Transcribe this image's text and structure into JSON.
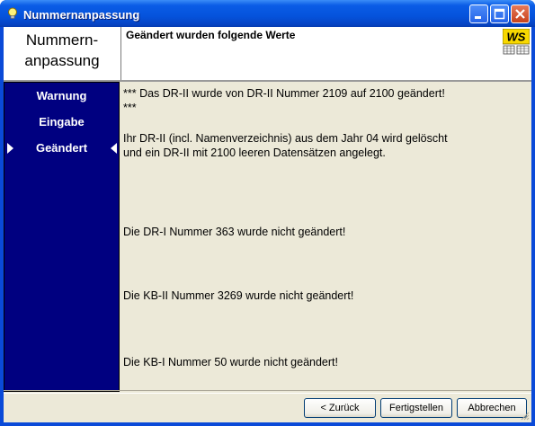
{
  "window": {
    "title": "Nummernanpassung"
  },
  "header": {
    "left_title_line1": "Nummern-",
    "left_title_line2": "anpassung",
    "heading": "Geändert wurden folgende Werte",
    "logo_text": "WS"
  },
  "sidebar": {
    "items": [
      {
        "label": "Warnung"
      },
      {
        "label": "Eingabe"
      },
      {
        "label": "Geändert",
        "active": true
      }
    ]
  },
  "content": {
    "paragraphs": [
      "*** Das DR-II wurde von DR-II Nummer 2109 auf 2100 geändert! ***",
      "Ihr DR-II (incl. Namenverzeichnis) aus dem Jahr 04 wird gelöscht und ein DR-II mit 2100 leeren Datensätzen angelegt.",
      "Die DR-I Nummer 363 wurde nicht geändert!",
      "Die KB-II Nummer 3269 wurde nicht geändert!",
      "Die KB-I Nummer 50 wurde nicht geändert!"
    ]
  },
  "buttons": {
    "back": "< Zurück",
    "finish": "Fertigstellen",
    "cancel": "Abbrechen"
  },
  "colors": {
    "titlebar": "#0553dc",
    "sidebar": "#000080",
    "logo_yellow": "#f8d800"
  }
}
